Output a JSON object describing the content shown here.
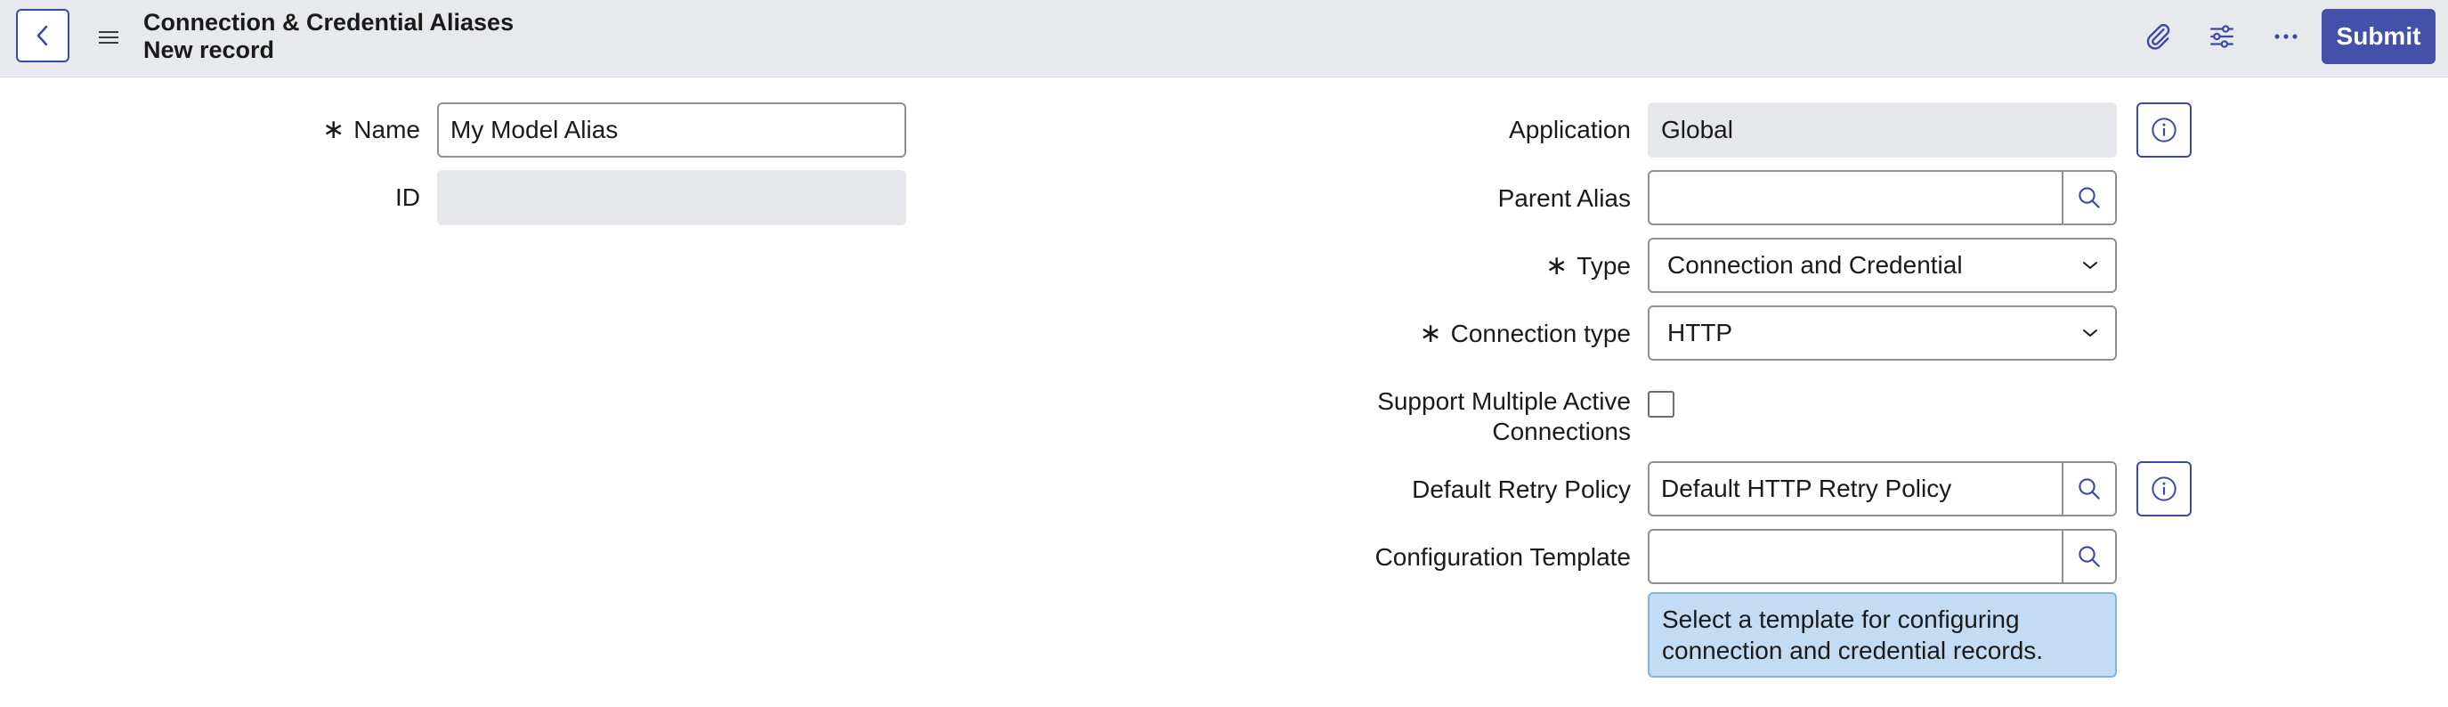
{
  "header": {
    "title": "Connection & Credential Aliases",
    "subtitle": "New record",
    "submit_label": "Submit",
    "icons": [
      "back-icon",
      "hamburger-menu-icon",
      "paperclip-icon",
      "sliders-icon",
      "more-icon"
    ]
  },
  "form": {
    "name": {
      "label": "Name",
      "required": true,
      "value": "My Model Alias"
    },
    "id": {
      "label": "ID",
      "value": ""
    },
    "application": {
      "label": "Application",
      "value": "Global"
    },
    "parent_alias": {
      "label": "Parent Alias",
      "value": ""
    },
    "type": {
      "label": "Type",
      "required": true,
      "value": "Connection and Credential"
    },
    "connection_type": {
      "label": "Connection type",
      "required": true,
      "value": "HTTP"
    },
    "support_multiple": {
      "label_line1": "Support Multiple Active",
      "label_line2": "Connections",
      "checked": false
    },
    "default_retry": {
      "label": "Default Retry Policy",
      "value": "Default HTTP Retry Policy"
    },
    "config_template": {
      "label": "Configuration Template",
      "value": "",
      "help_line1": "Select a template for configuring",
      "help_line2": "connection and credential records."
    },
    "required_marker": "∗"
  },
  "colors": {
    "header_bg": "#e8e9ec",
    "accent": "#4451a8",
    "readonly_bg": "#e6e7ea",
    "help_bg": "#c3dcf3"
  }
}
